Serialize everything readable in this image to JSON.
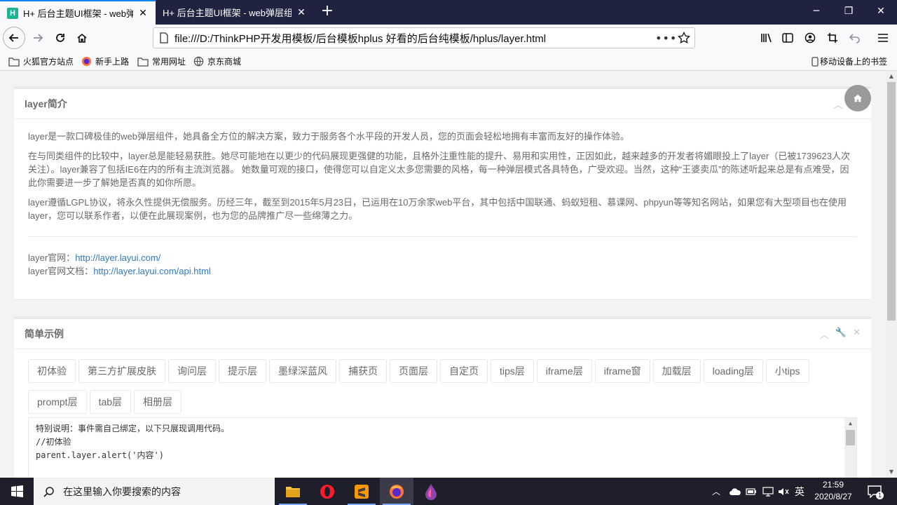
{
  "browser": {
    "tabs": [
      {
        "favicon": "H",
        "title": "H+ 后台主题UI框架 - web弹层",
        "close": "✕"
      },
      {
        "title": "H+ 后台主题UI框架 - web弹层组件",
        "close": "✕"
      }
    ],
    "new_tab": "+",
    "url": "file:///D:/ThinkPHP开发用模板/后台模板hplus 好看的后台纯模板/hplus/layer.html",
    "url_more": "•••",
    "window_controls": {
      "minimize": "─",
      "restore": "❐",
      "close": "✕"
    }
  },
  "bookmarks": {
    "items": [
      {
        "icon": "folder-icon",
        "label": "火狐官方站点"
      },
      {
        "icon": "firefox-icon",
        "label": "新手上路"
      },
      {
        "icon": "folder-icon",
        "label": "常用网址"
      },
      {
        "icon": "globe-icon",
        "label": "京东商城"
      }
    ],
    "mobile": "移动设备上的书签"
  },
  "panel1": {
    "title": "layer简介",
    "paragraphs": [
      "layer是一款口碑极佳的web弹层组件，她具备全方位的解决方案，致力于服务各个水平段的开发人员，您的页面会轻松地拥有丰富而友好的操作体验。",
      "在与同类组件的比较中，layer总是能轻易获胜。她尽可能地在以更少的代码展现更强健的功能，且格外注重性能的提升、易用和实用性，正因如此，越来越多的开发者将媚眼投上了layer（已被1739623人次关注）。layer兼容了包括IE6在内的所有主流浏览器。 她数量可观的接口，使得您可以自定义太多您需要的风格，每一种弹层模式各具特色，广受欢迎。当然，这种“王婆卖瓜”的陈述听起来总是有点难受，因此你需要进一步了解她是否真的如你所愿。",
      "layer遵循LGPL协议，将永久性提供无偿服务。历经三年，截至到2015年5月23日，已运用在10万余家web平台，其中包括中国联通、蚂蚁短租、慕课网、phpyun等等知名网站，如果您有大型项目也在使用layer，您可以联系作者，以便在此展现案例，也为您的品牌推广尽一些绵薄之力。"
    ],
    "site_label": "layer官网：",
    "site_link": "http://layer.layui.com/",
    "doc_label": "layer官网文档：",
    "doc_link": "http://layer.layui.com/api.html"
  },
  "panel2": {
    "title": "简单示例",
    "buttons_row1": [
      "初体验",
      "第三方扩展皮肤",
      "询问层",
      "提示层",
      "墨绿深蓝风",
      "捕获页",
      "页面层",
      "自定页",
      "tips层",
      "iframe层",
      "iframe窗",
      "加载层",
      "loading层",
      "小tips"
    ],
    "buttons_row2": [
      "prompt层",
      "tab层",
      "相册层"
    ],
    "code_lines": [
      "特别说明：事件需自己绑定，以下只展现调用代码。",
      "//初体验",
      "parent.layer.alert('内容')"
    ]
  },
  "taskbar": {
    "search_placeholder": "在这里输入你要搜索的内容",
    "ime": "英",
    "time": "21:59",
    "date": "2020/8/27",
    "notification_count": "1"
  },
  "colors": {
    "accent": "#0a84ff",
    "brand": "#1ab394",
    "link": "#337ab7",
    "titlebar": "#202340",
    "taskbar": "#1f1f2b"
  }
}
